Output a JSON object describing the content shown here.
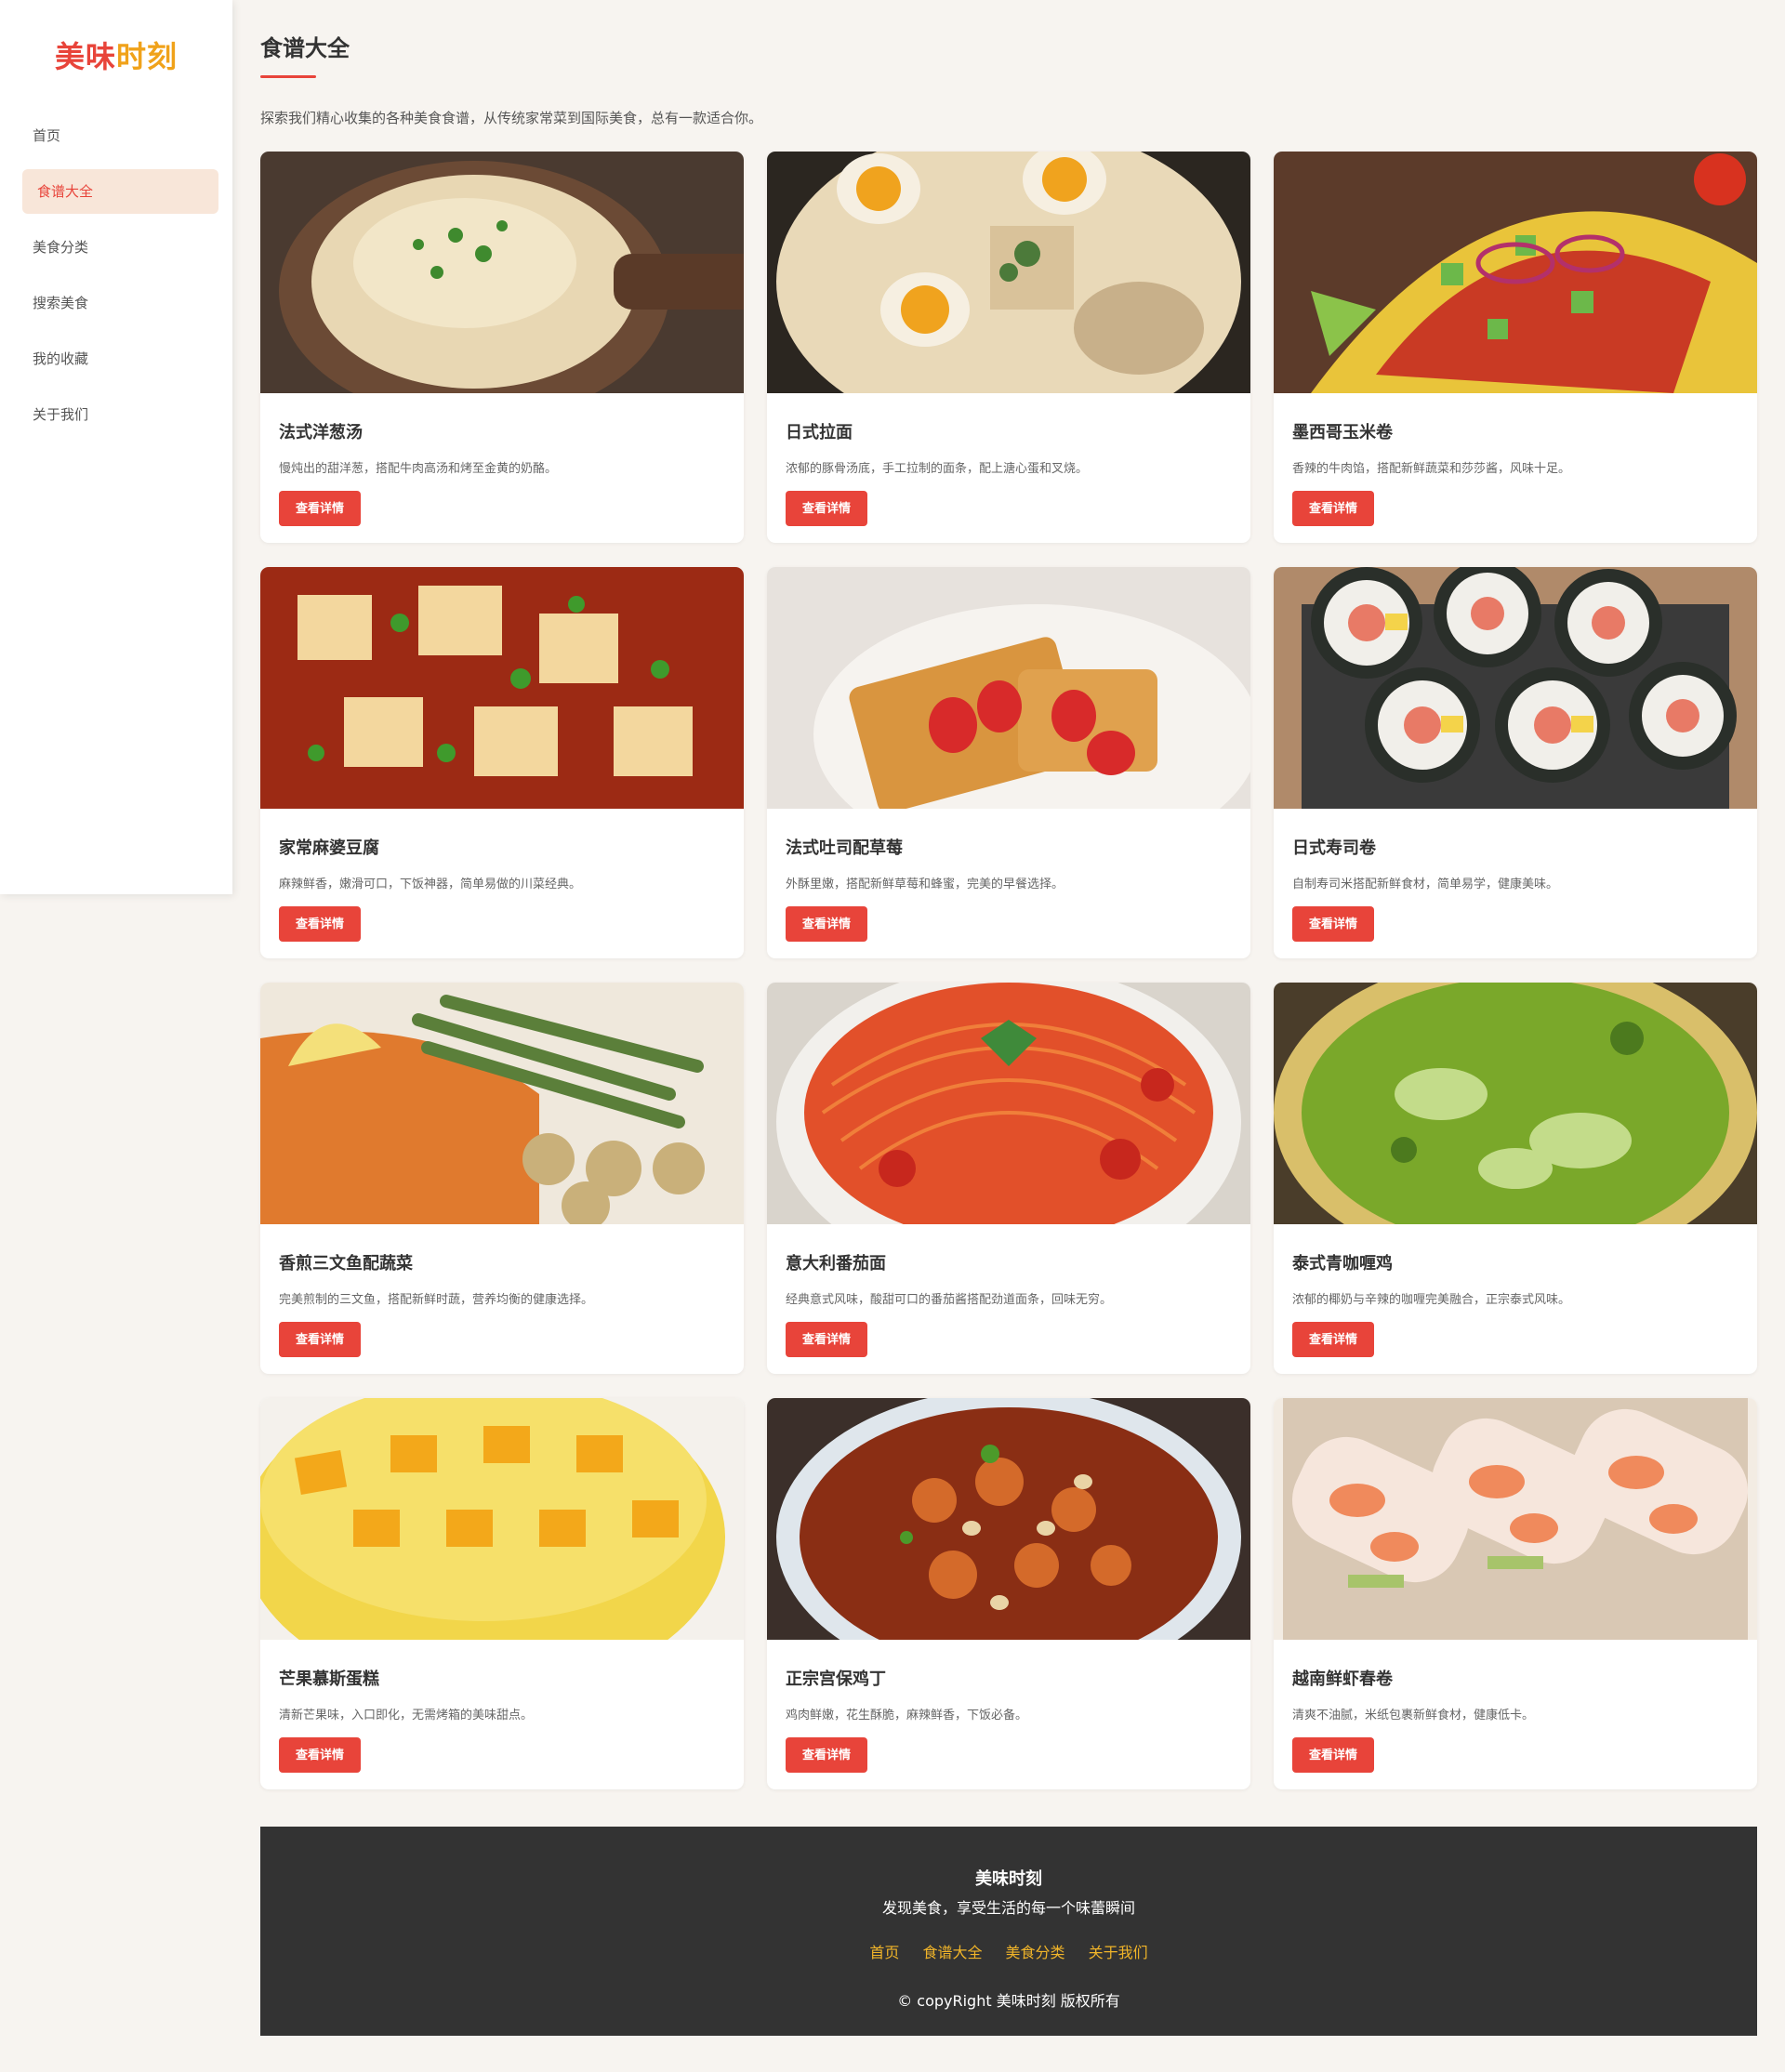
{
  "brand": {
    "part1": "美味",
    "part2": "时刻",
    "color1": "#e8443a",
    "color2": "#f0a21a"
  },
  "nav": [
    {
      "label": "首页",
      "active": false
    },
    {
      "label": "食谱大全",
      "active": true
    },
    {
      "label": "美食分类",
      "active": false
    },
    {
      "label": "搜索美食",
      "active": false
    },
    {
      "label": "我的收藏",
      "active": false
    },
    {
      "label": "关于我们",
      "active": false
    }
  ],
  "page": {
    "title": "食谱大全",
    "intro": "探索我们精心收集的各种美食食谱，从传统家常菜到国际美食，总有一款适合你。"
  },
  "button_label": "查看详情",
  "recipes": [
    {
      "title": "法式洋葱汤",
      "desc": "慢炖出的甜洋葱，搭配牛肉高汤和烤至金黄的奶酪。",
      "image": "french-onion-soup"
    },
    {
      "title": "日式拉面",
      "desc": "浓郁的豚骨汤底，手工拉制的面条，配上溏心蛋和叉烧。",
      "image": "ramen"
    },
    {
      "title": "墨西哥玉米卷",
      "desc": "香辣的牛肉馅，搭配新鲜蔬菜和莎莎酱，风味十足。",
      "image": "taco"
    },
    {
      "title": "家常麻婆豆腐",
      "desc": "麻辣鲜香，嫩滑可口，下饭神器，简单易做的川菜经典。",
      "image": "mapo-tofu"
    },
    {
      "title": "法式吐司配草莓",
      "desc": "外酥里嫩，搭配新鲜草莓和蜂蜜，完美的早餐选择。",
      "image": "french-toast"
    },
    {
      "title": "日式寿司卷",
      "desc": "自制寿司米搭配新鲜食材，简单易学，健康美味。",
      "image": "sushi"
    },
    {
      "title": "香煎三文鱼配蔬菜",
      "desc": "完美煎制的三文鱼，搭配新鲜时蔬，营养均衡的健康选择。",
      "image": "salmon"
    },
    {
      "title": "意大利番茄面",
      "desc": "经典意式风味，酸甜可口的番茄酱搭配劲道面条，回味无穷。",
      "image": "spaghetti"
    },
    {
      "title": "泰式青咖喱鸡",
      "desc": "浓郁的椰奶与辛辣的咖喱完美融合，正宗泰式风味。",
      "image": "green-curry"
    },
    {
      "title": "芒果慕斯蛋糕",
      "desc": "清新芒果味，入口即化，无需烤箱的美味甜点。",
      "image": "mango-cake"
    },
    {
      "title": "正宗宫保鸡丁",
      "desc": "鸡肉鲜嫩，花生酥脆，麻辣鲜香，下饭必备。",
      "image": "kung-pao"
    },
    {
      "title": "越南鲜虾春卷",
      "desc": "清爽不油腻，米纸包裹新鲜食材，健康低卡。",
      "image": "spring-roll"
    }
  ],
  "footer": {
    "title": "美味时刻",
    "subtitle": "发现美食，享受生活的每一个味蕾瞬间",
    "links": [
      "首页",
      "食谱大全",
      "美食分类",
      "关于我们"
    ],
    "copyright": "© copyRight 美味时刻 版权所有"
  }
}
